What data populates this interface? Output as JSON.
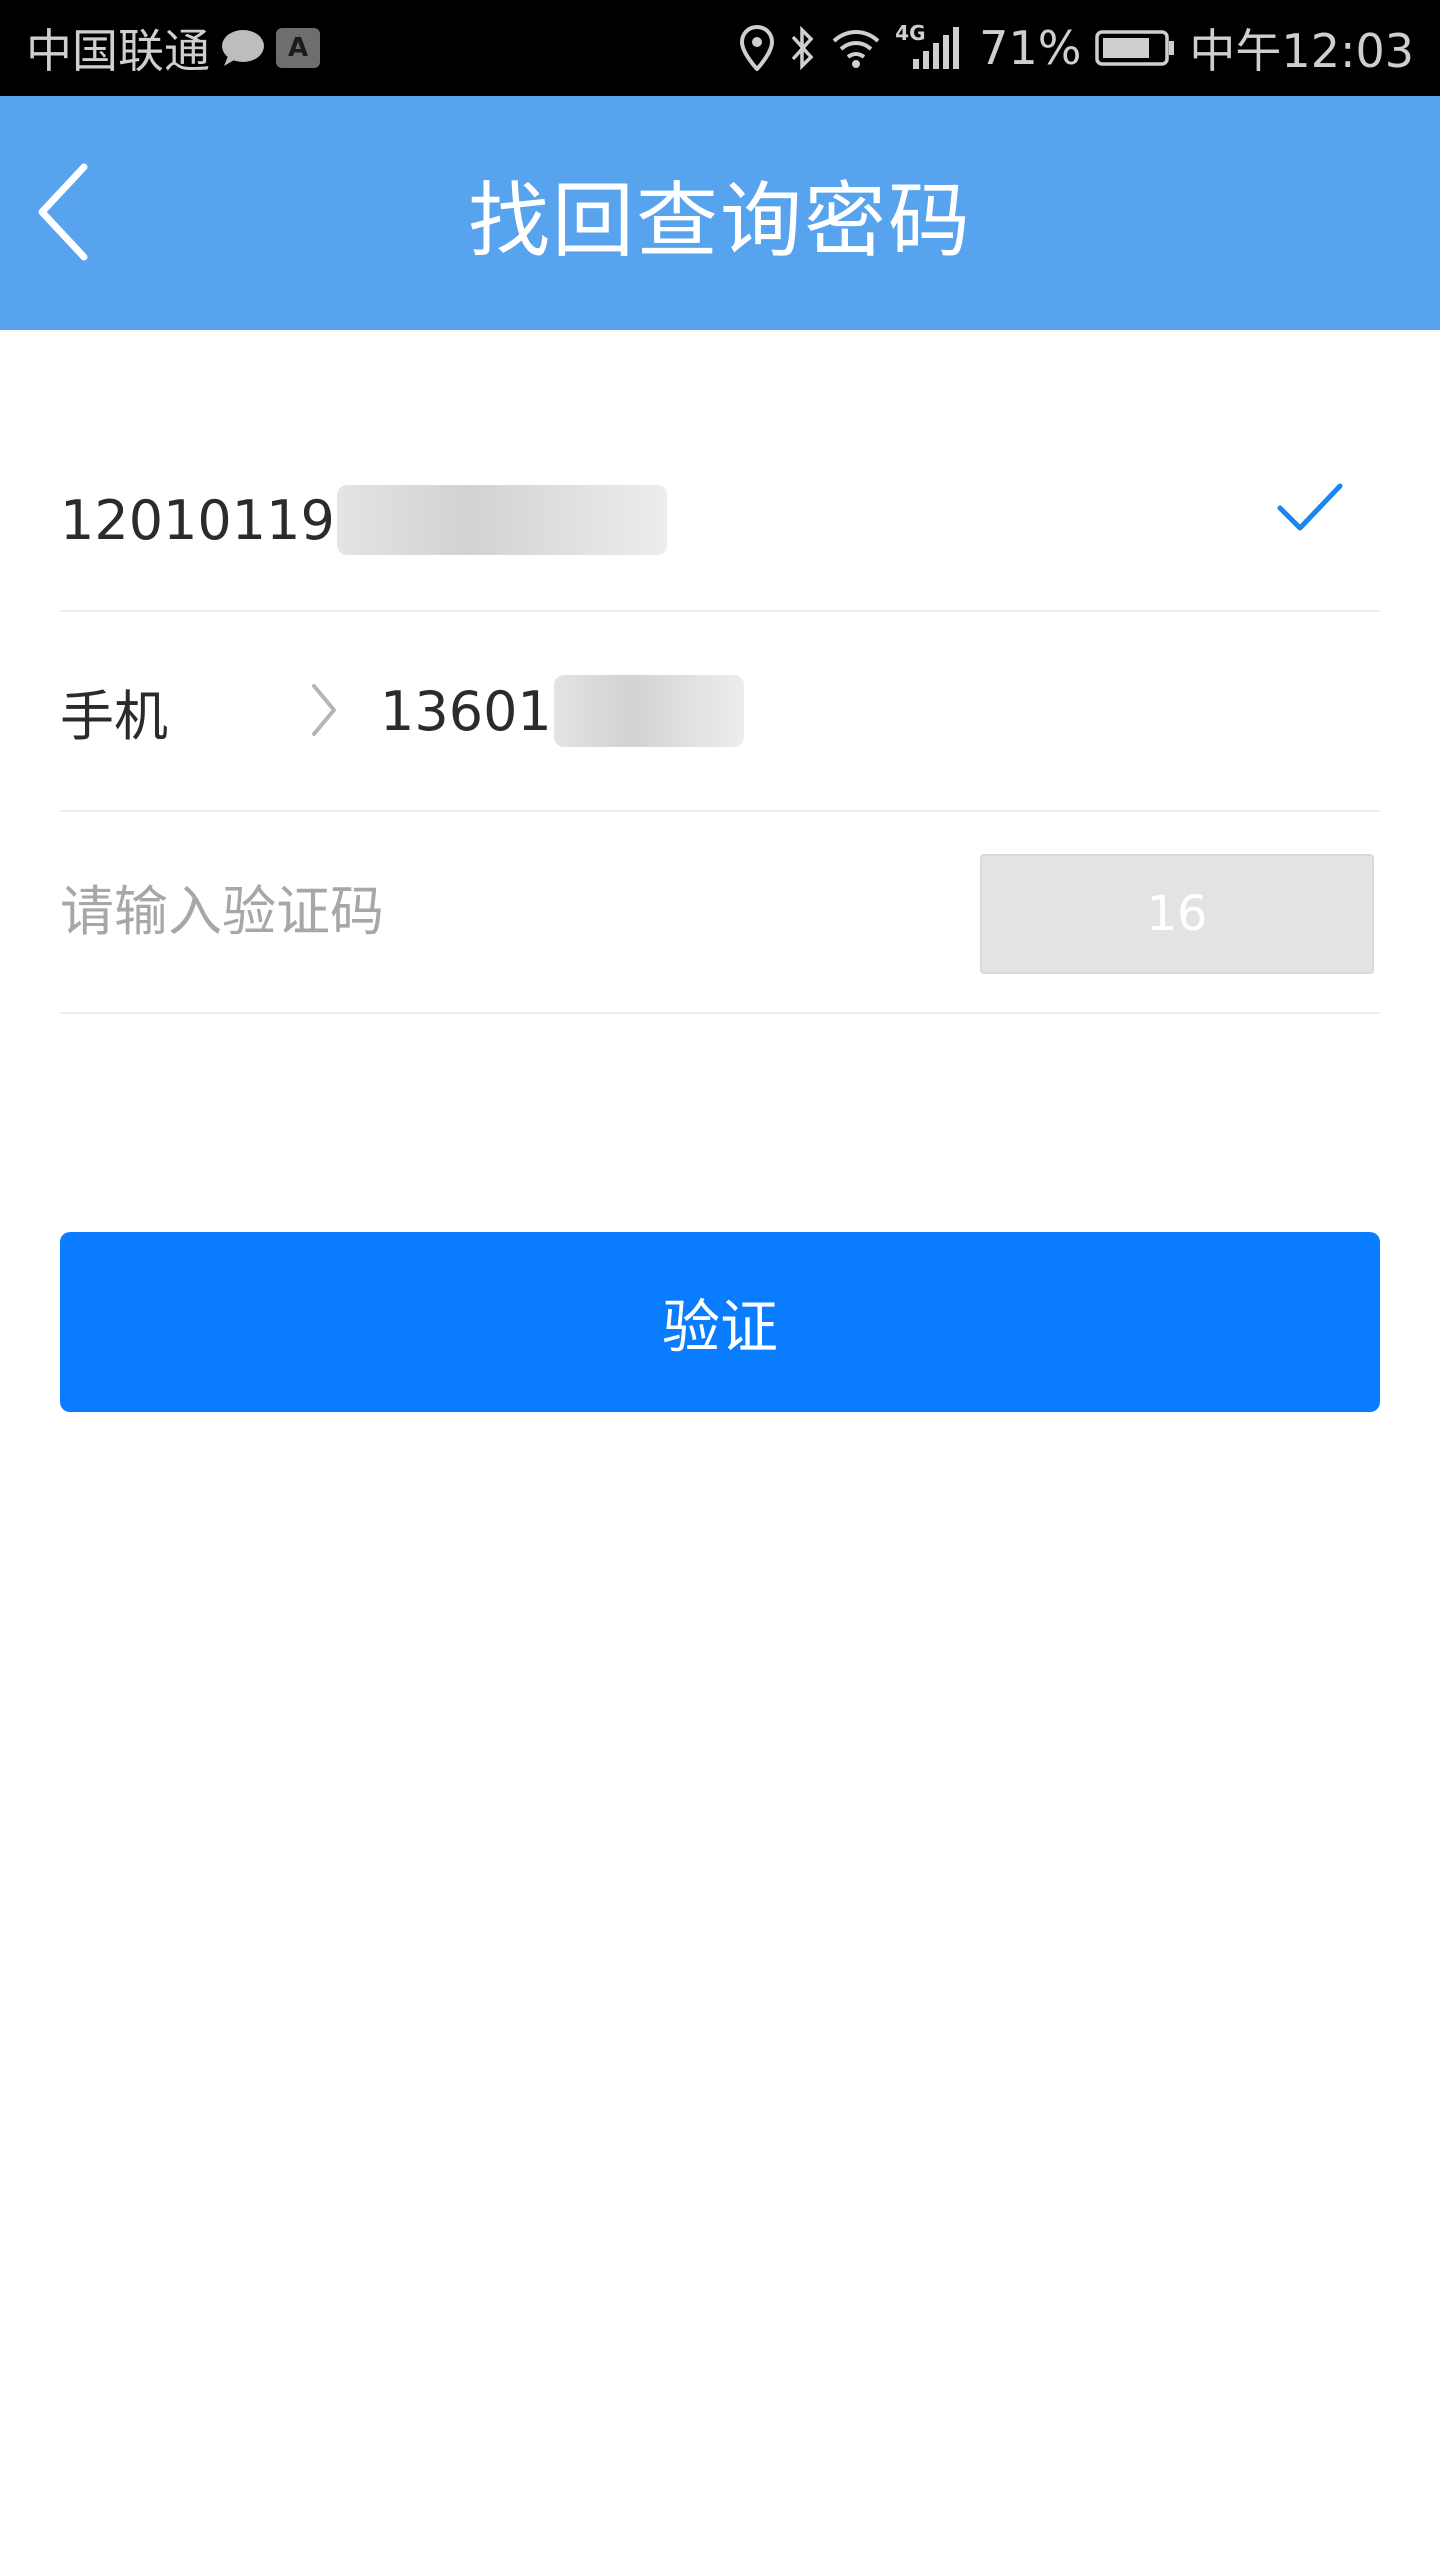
{
  "status_bar": {
    "carrier": "中国联通",
    "battery_percent": "71%",
    "time": "中午12:03",
    "network_type": "4G",
    "app_badge": "A",
    "icons": [
      "message-icon",
      "app-badge-icon",
      "location-icon",
      "bluetooth-icon",
      "wifi-icon",
      "signal-icon",
      "battery-icon"
    ]
  },
  "header": {
    "title": "找回查询密码",
    "back_icon": "back-chevron-icon",
    "background_color": "#57a3ee"
  },
  "form": {
    "id_number_visible": "12010119",
    "id_verified_icon": "check-icon",
    "phone_label": "手机",
    "phone_value_visible": "13601",
    "code_placeholder": "请输入验证码",
    "code_value": "",
    "countdown": "16"
  },
  "actions": {
    "verify_label": "验证",
    "verify_color": "#0a7cff"
  },
  "accent_color": "#1a86f0"
}
